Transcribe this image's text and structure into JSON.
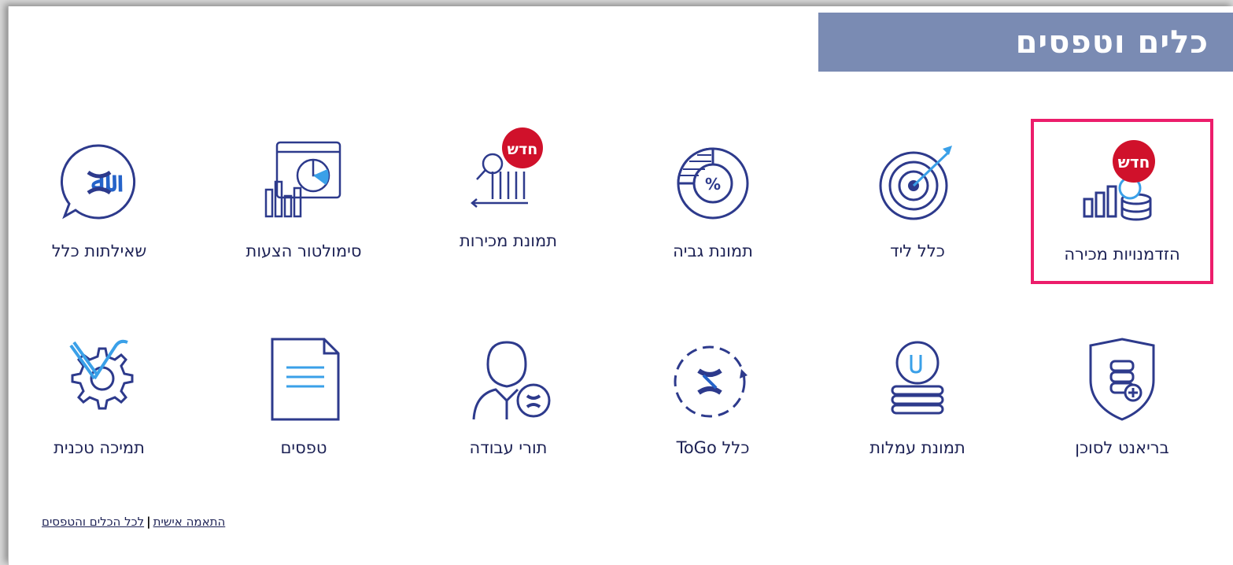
{
  "header": {
    "title": "כלים וטפסים"
  },
  "tiles_row1": [
    {
      "label": "הזדמנויות מכירה",
      "badge": "חדש",
      "icon": "sales-opportunities-icon",
      "highlighted": true
    },
    {
      "label": "כלל ליד",
      "icon": "target-icon"
    },
    {
      "label": "תמונת גביה",
      "icon": "percent-donut-icon"
    },
    {
      "label": "תמונת מכירות",
      "badge": "חדש",
      "icon": "sales-chart-icon"
    },
    {
      "label": "סימולטור הצעות",
      "icon": "simulator-icon"
    },
    {
      "label": "שאילתות כלל",
      "icon": "chat-logo-icon"
    }
  ],
  "tiles_row2": [
    {
      "label": "בריאנט לסוכן",
      "icon": "shield-coins-icon"
    },
    {
      "label": "תמונת עמלות",
      "icon": "coin-stack-icon"
    },
    {
      "label": "כלל ToGo",
      "icon": "togo-icon"
    },
    {
      "label": "תורי עבודה",
      "icon": "agent-icon"
    },
    {
      "label": "טפסים",
      "icon": "document-icon"
    },
    {
      "label": "תמיכה טכנית",
      "icon": "tools-gear-icon"
    }
  ],
  "footer_links": {
    "personal": "התאמה אישית",
    "separator": "|",
    "all_tools": "לכל הכלים והטפסים"
  },
  "colors": {
    "accent": "#7a8bb3",
    "highlight": "#ec1d6b",
    "icon_primary": "#2d3a8c",
    "icon_light": "#3aa0e8",
    "badge": "#d0112b"
  }
}
